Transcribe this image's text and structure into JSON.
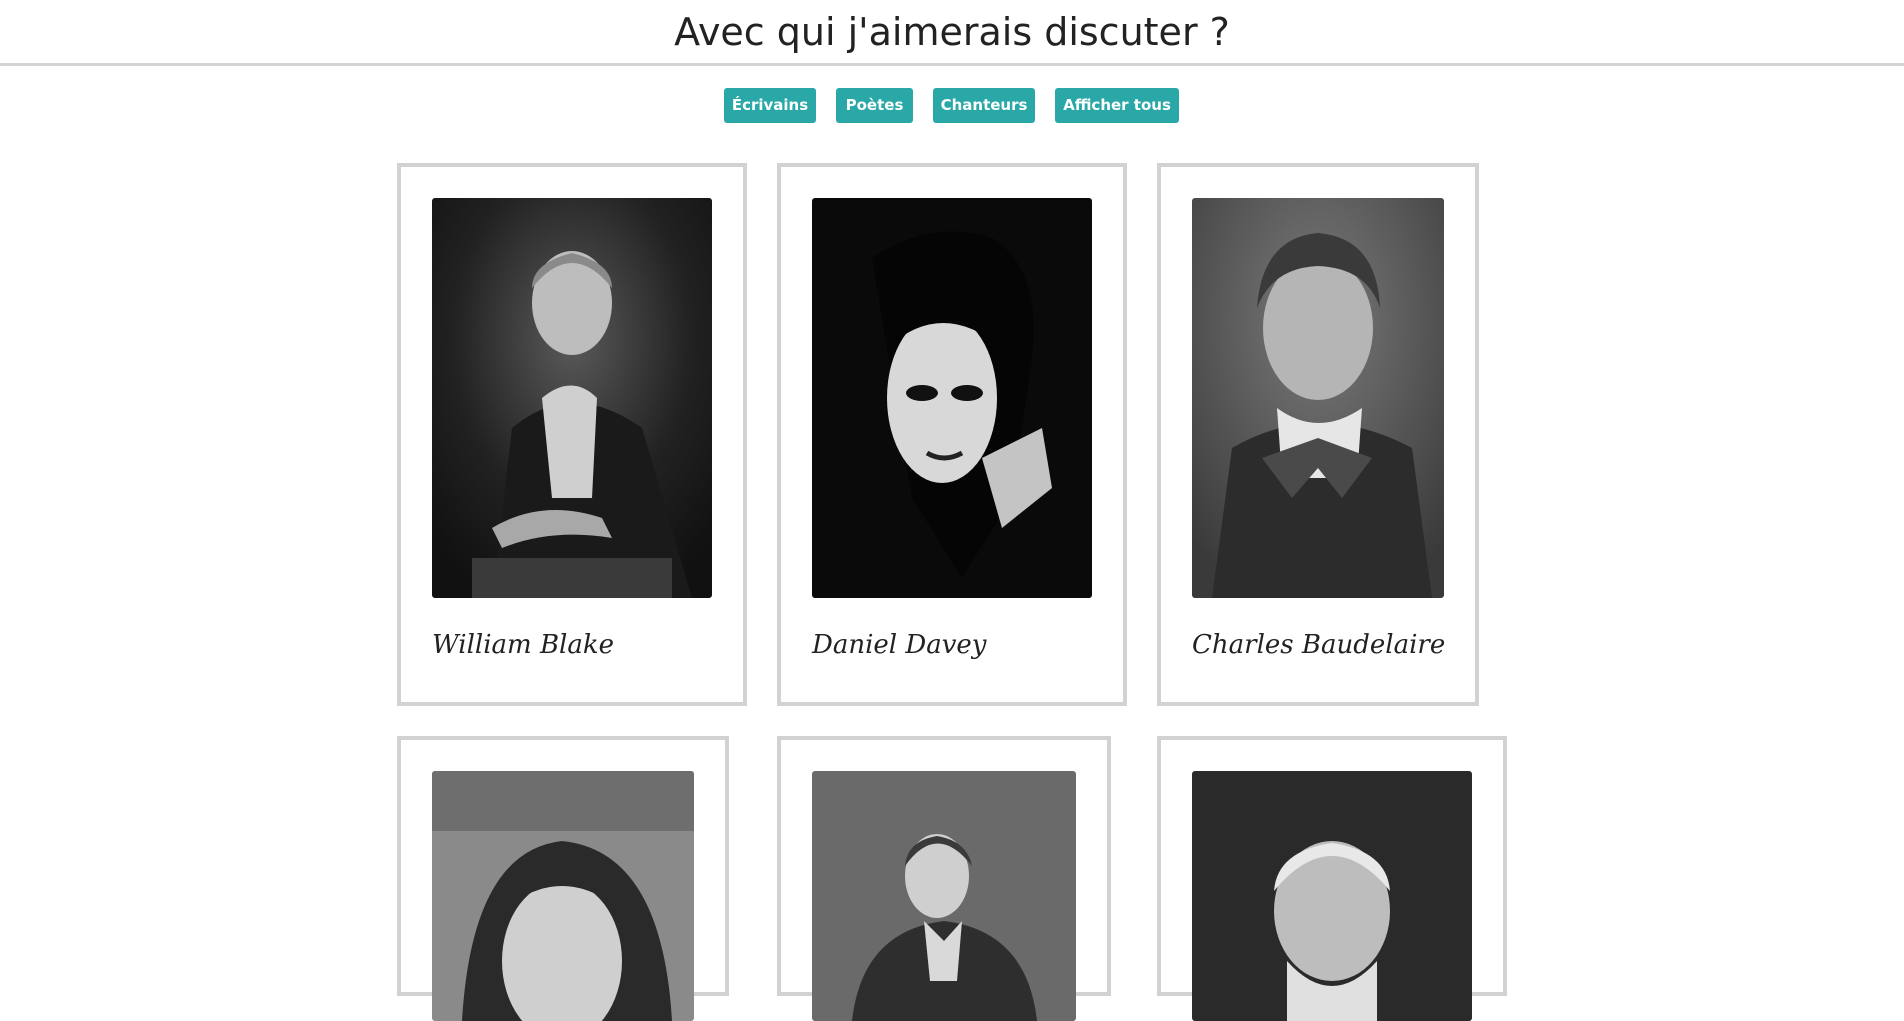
{
  "header": {
    "title": "Avec qui j'aimerais discuter ?"
  },
  "filters": [
    {
      "label": "Écrivains"
    },
    {
      "label": "Poètes"
    },
    {
      "label": "Chanteurs"
    },
    {
      "label": "Afficher tous"
    }
  ],
  "cards": [
    {
      "name": "William Blake"
    },
    {
      "name": "Daniel Davey"
    },
    {
      "name": "Charles Baudelaire"
    },
    {
      "name": ""
    },
    {
      "name": ""
    },
    {
      "name": ""
    }
  ],
  "colors": {
    "button_bg": "#2aa8a8",
    "button_text": "#ffffff",
    "card_border": "#d2d2d2",
    "divider": "#d4d4d4"
  }
}
